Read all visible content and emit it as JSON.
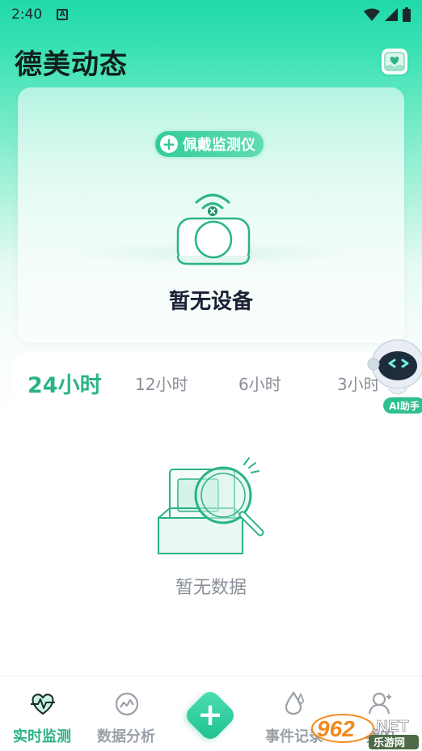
{
  "status_bar": {
    "time": "2:40",
    "notification_letter": "A"
  },
  "header": {
    "title": "德美动态",
    "icon": "heart-card-icon"
  },
  "device_card": {
    "wear_button_label": "佩戴监测仪",
    "no_device_text": "暂无设备"
  },
  "range_tabs": [
    {
      "label": "24小时",
      "active": true
    },
    {
      "label": "12小时",
      "active": false
    },
    {
      "label": "6小时",
      "active": false
    },
    {
      "label": "3小时",
      "active": false
    }
  ],
  "empty_state": {
    "text": "暂无数据"
  },
  "ai_assistant": {
    "label": "AI助手"
  },
  "bottom_nav": [
    {
      "label": "实时监测",
      "icon": "heart-pulse-icon",
      "active": true
    },
    {
      "label": "数据分析",
      "icon": "gauge-icon",
      "active": false
    },
    {
      "label": "",
      "icon": "plus-icon",
      "active": false
    },
    {
      "label": "事件记录",
      "icon": "droplet-icon",
      "active": false
    },
    {
      "label": "我的",
      "icon": "user-icon",
      "active": false
    }
  ],
  "watermark": {
    "brand": "962",
    "suffix": ".NET",
    "sub": "乐游网"
  },
  "colors": {
    "accent": "#2bb387",
    "header_gradient_top": "#1fd9a9",
    "inactive": "#9aa0a8"
  }
}
